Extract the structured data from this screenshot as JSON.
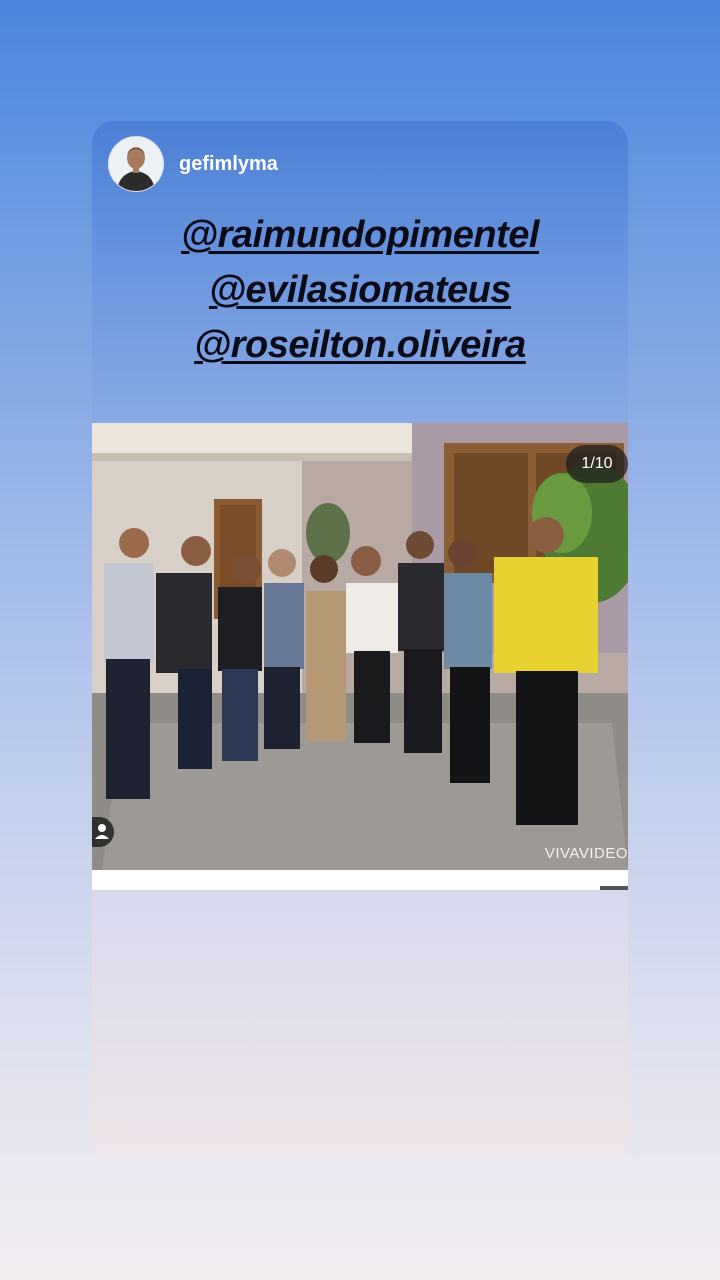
{
  "story": {
    "username": "gefimlyma",
    "mentions": [
      "@raimundopimentel",
      "@evilasiomateus",
      "@roseilton.oliveira"
    ],
    "post": {
      "slide_counter": "1/10",
      "watermark": "VIVAVIDEO"
    }
  },
  "colors": {
    "background_top": "#4a86dc",
    "background_bottom": "#f1ecf0",
    "mention_text": "#0b0b18",
    "shirt_yellow": "#e8d232"
  },
  "icons": {
    "tag": "person-tag-icon"
  }
}
